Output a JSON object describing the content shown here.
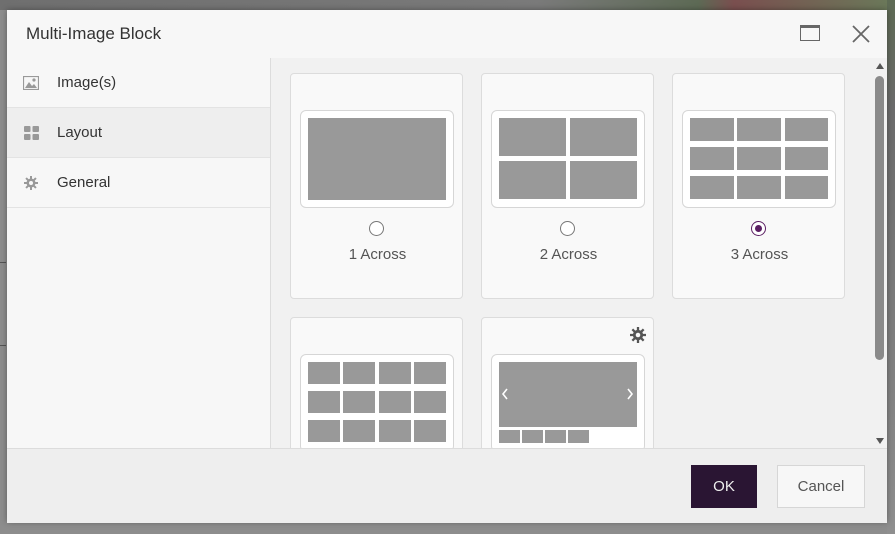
{
  "dialog": {
    "title": "Multi-Image Block",
    "maximize_icon": "maximize-icon",
    "close_icon": "close-icon"
  },
  "sidebar": {
    "items": [
      {
        "label": "Image(s)",
        "icon": "image-icon",
        "active": false
      },
      {
        "label": "Layout",
        "icon": "grid-icon",
        "active": true
      },
      {
        "label": "General",
        "icon": "gear-icon",
        "active": false
      }
    ]
  },
  "layouts": [
    {
      "label": "1 Across",
      "selected": false
    },
    {
      "label": "2 Across",
      "selected": false
    },
    {
      "label": "3 Across",
      "selected": true
    },
    {
      "label": "",
      "selected": false
    },
    {
      "label": "",
      "selected": false,
      "has_settings": true
    }
  ],
  "footer": {
    "ok_label": "OK",
    "cancel_label": "Cancel"
  },
  "colors": {
    "accent": "#5b1f63",
    "ok_bg": "#2a1533"
  }
}
